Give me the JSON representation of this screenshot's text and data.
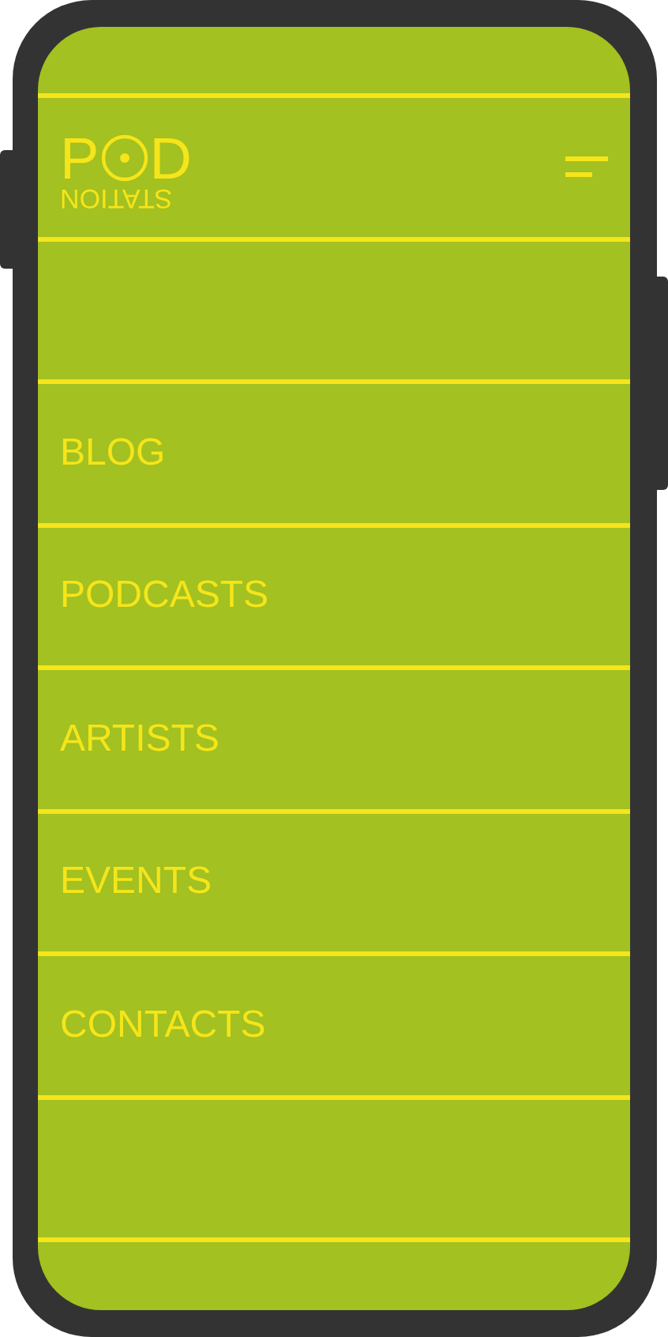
{
  "header": {
    "logo": {
      "left_letter": "P",
      "right_letter": "D",
      "subtitle": "STATION"
    }
  },
  "nav": {
    "items": [
      {
        "label": "BLOG"
      },
      {
        "label": "PODCASTS"
      },
      {
        "label": "ARTISTS"
      },
      {
        "label": "EVENTS"
      },
      {
        "label": "CONTACTS"
      }
    ]
  }
}
